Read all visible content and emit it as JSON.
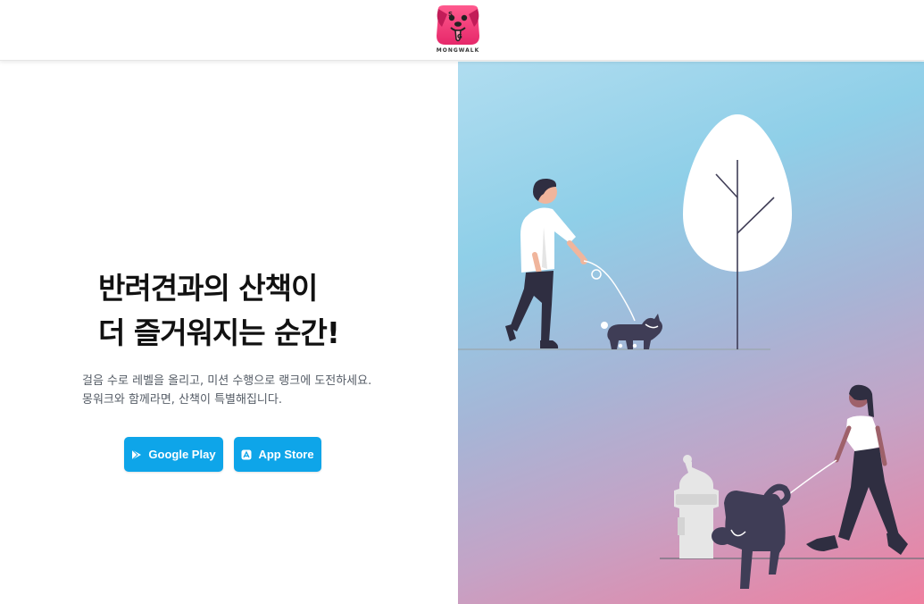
{
  "header": {
    "logo_text": "MONGWALK",
    "logo_alt": "dog-logo-icon"
  },
  "hero": {
    "headline_line1": "반려견과의 산책이",
    "headline_line2": "더 즐거워지는 순간!",
    "description_line1": "걸음 수로 레벨을 올리고, 미션 수행으로 랭크에 도전하세요.",
    "description_line2": "몽워크와 함께라면, 산책이 특별해집니다."
  },
  "buttons": {
    "google_play_label": "Google Play",
    "app_store_label": "App Store",
    "google_play_icon": "play-store-icon",
    "app_store_icon": "app-store-icon"
  },
  "colors": {
    "accent": "#0ea5e9",
    "logo_pink": "#f0437c",
    "headline": "#111111",
    "body_text": "#555c66"
  },
  "illustration": {
    "subjects": [
      "man-walking-dog",
      "tree",
      "woman-walking-dog",
      "fire-hydrant"
    ]
  }
}
